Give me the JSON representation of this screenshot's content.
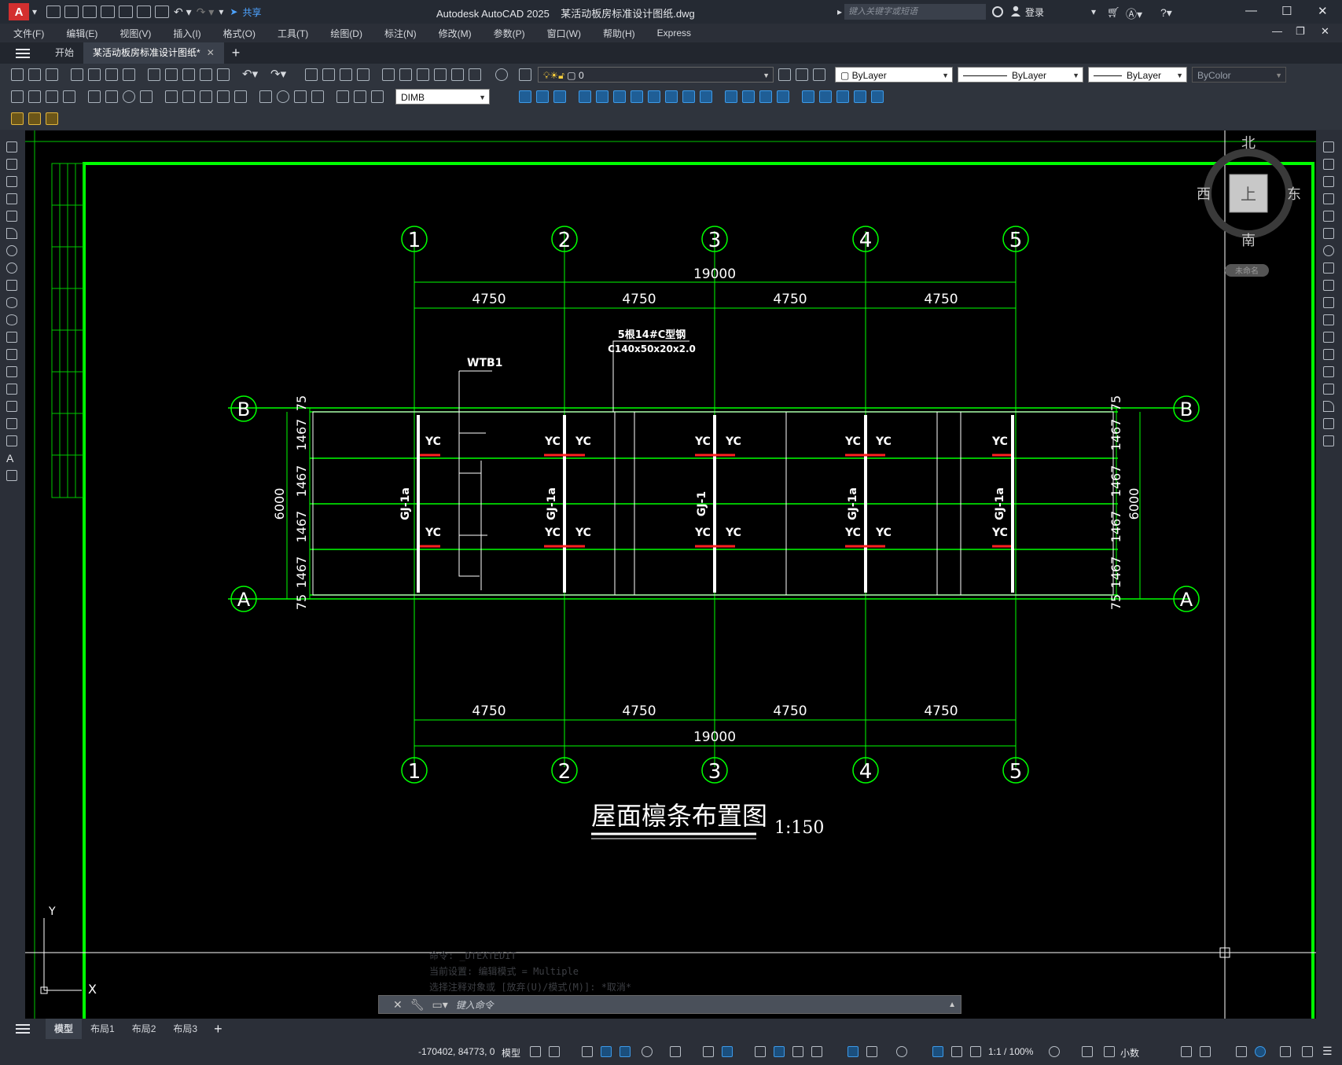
{
  "app": {
    "title": "Autodesk AutoCAD 2025",
    "document": "某活动板房标准设计图纸.dwg",
    "logo_letter": "A",
    "share_label": "共享",
    "search_placeholder": "键入关键字或短语",
    "login_label": "登录"
  },
  "menu": [
    "文件(F)",
    "编辑(E)",
    "视图(V)",
    "插入(I)",
    "格式(O)",
    "工具(T)",
    "绘图(D)",
    "标注(N)",
    "修改(M)",
    "参数(P)",
    "窗口(W)",
    "帮助(H)",
    "Express"
  ],
  "tabs": {
    "start_label": "开始",
    "drawing_label": "某活动板房标准设计图纸*",
    "close_glyph": "✕",
    "add_glyph": "+"
  },
  "properties": {
    "layer": "0",
    "color": "ByLayer",
    "linetype": "ByLayer",
    "lineweight": "ByLayer",
    "plotstyle": "ByColor",
    "dimstyle": "DIMB"
  },
  "viewcube": {
    "north": "北",
    "south": "南",
    "east": "东",
    "west": "西",
    "face": "上",
    "wcs": "未命名"
  },
  "drawing": {
    "axes_columns": [
      "1",
      "2",
      "3",
      "4",
      "5"
    ],
    "axes_rows": [
      "B",
      "A"
    ],
    "total_width": "19000",
    "bay_width": "4750",
    "total_depth": "6000",
    "purlin_spacing": "1467",
    "edge_offset": "75",
    "ucs_y": "Y",
    "ucs_x": "X",
    "note_line1": "5根14#C型钢",
    "note_line2": "C140x50x20x2.0",
    "wtb_label": "WTB1",
    "yc_label": "YC",
    "frame_labels": [
      "GJ-1a",
      "GJ-1a",
      "GJ-1",
      "GJ-1a",
      "GJ-1a"
    ],
    "title": "屋面檩条布置图",
    "scale": "1:150"
  },
  "command": {
    "placeholder": "键入命令",
    "history": [
      "命令: _DTEXTEDIT",
      "当前设置: 编辑模式 = Multiple",
      "选择注释对象或 [放弃(U)/模式(M)]: *取消*"
    ]
  },
  "layouts": {
    "model": "模型",
    "layout1": "布局1",
    "layout2": "布局2",
    "layout3": "布局3"
  },
  "status": {
    "coordinates": "-170402, 84773, 0",
    "space": "模型",
    "annotation_scale": "1:1 / 100%",
    "units": "小数"
  },
  "colors": {
    "drawing_green": "#00ff00",
    "accent_red": "#ff2020",
    "background": "#000000",
    "ui_dark": "#2b2f38"
  }
}
